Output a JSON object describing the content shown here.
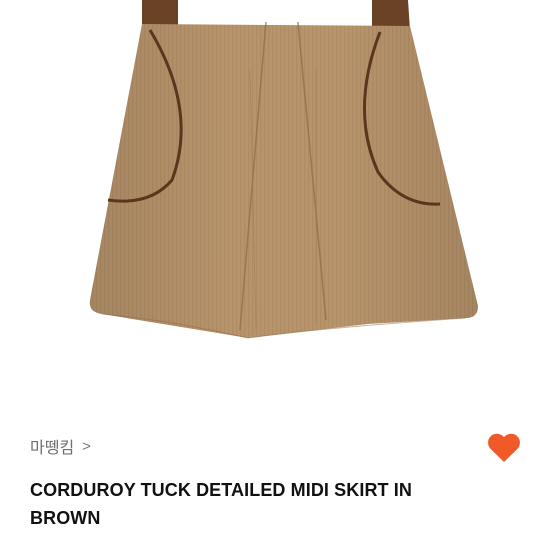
{
  "product": {
    "brand_label": "마뗑킴",
    "brand_chevron": ">",
    "title": "CORDUROY TUCK DETAILED MIDI SKIRT IN BROWN",
    "favorite_icon": "heart-icon",
    "image_subject": "skirt"
  },
  "colors": {
    "heart": "#f05a28",
    "skirt_base": "#b8946c",
    "skirt_trim": "#6a4226",
    "title_text": "#111111",
    "brand_text": "#6f6f6f"
  }
}
